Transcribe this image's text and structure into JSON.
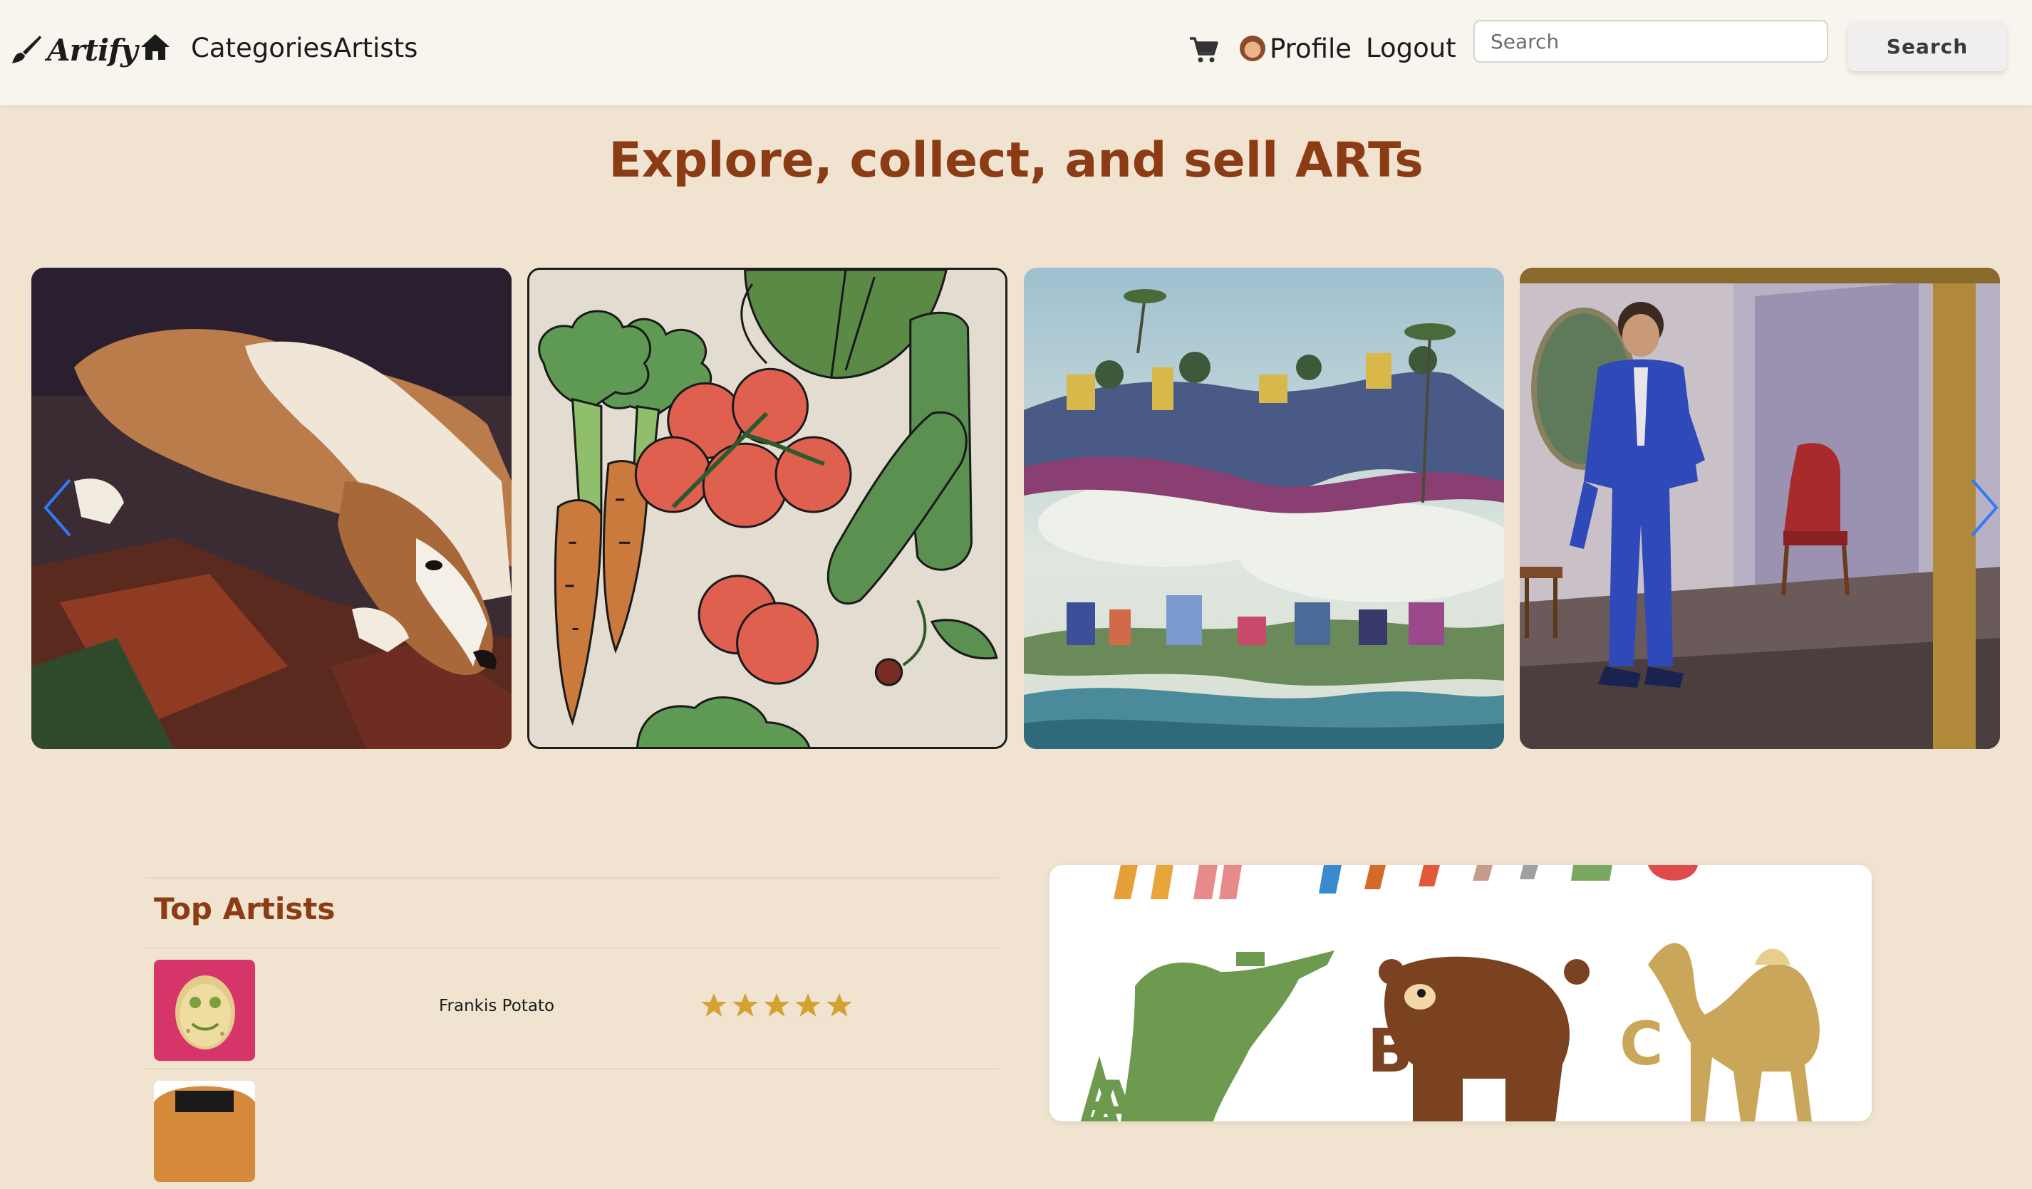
{
  "navbar": {
    "brand": {
      "name": "Artify",
      "icon": "paintbrush-icon"
    },
    "home_icon": "home-icon",
    "links": {
      "categories": "Categories",
      "artists": "Artists"
    },
    "cart_icon": "shopping-cart-icon",
    "profile": {
      "label": "Profile",
      "avatar": "user-avatar"
    },
    "logout": "Logout",
    "search": {
      "placeholder": "Search",
      "value": "",
      "button_label": "Search"
    }
  },
  "hero": {
    "title": "Explore, collect, and sell ARTs",
    "carousel": {
      "prev_icon": "chevron-left-icon",
      "next_icon": "chevron-right-icon",
      "slides": [
        {
          "subject": "collie-dog-painting"
        },
        {
          "subject": "vegetables-illustration"
        },
        {
          "subject": "surreal-oasis-city-painting"
        },
        {
          "subject": "man-in-blue-suit-painting"
        }
      ]
    }
  },
  "top_artists": {
    "title": "Top Artists",
    "items": [
      {
        "name": "Frankis Potato",
        "rating": 5,
        "rating_max": 5
      },
      {
        "name": ""
      }
    ]
  },
  "featured": {
    "letters": [
      "A",
      "B",
      "C"
    ],
    "subject": "alphabet-animals-illustration"
  },
  "colors": {
    "page_background": "#f0e4d0",
    "navbar_background": "#f8f4ee",
    "heading_brown": "#8b3c15",
    "star_gold": "#d4a233",
    "arrow_blue": "#2f7cf6"
  }
}
